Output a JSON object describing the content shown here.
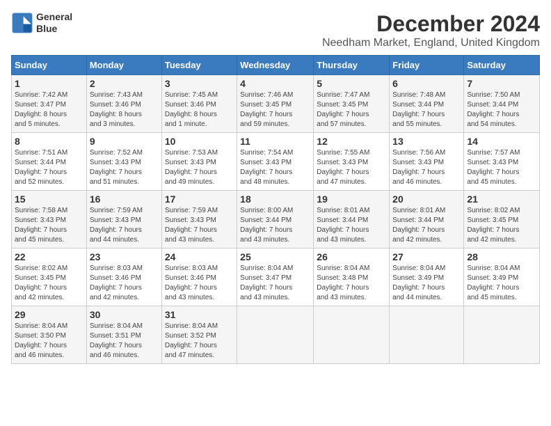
{
  "header": {
    "logo_line1": "General",
    "logo_line2": "Blue",
    "month": "December 2024",
    "location": "Needham Market, England, United Kingdom"
  },
  "weekdays": [
    "Sunday",
    "Monday",
    "Tuesday",
    "Wednesday",
    "Thursday",
    "Friday",
    "Saturday"
  ],
  "weeks": [
    [
      {
        "day": "1",
        "info": "Sunrise: 7:42 AM\nSunset: 3:47 PM\nDaylight: 8 hours\nand 5 minutes."
      },
      {
        "day": "2",
        "info": "Sunrise: 7:43 AM\nSunset: 3:46 PM\nDaylight: 8 hours\nand 3 minutes."
      },
      {
        "day": "3",
        "info": "Sunrise: 7:45 AM\nSunset: 3:46 PM\nDaylight: 8 hours\nand 1 minute."
      },
      {
        "day": "4",
        "info": "Sunrise: 7:46 AM\nSunset: 3:45 PM\nDaylight: 7 hours\nand 59 minutes."
      },
      {
        "day": "5",
        "info": "Sunrise: 7:47 AM\nSunset: 3:45 PM\nDaylight: 7 hours\nand 57 minutes."
      },
      {
        "day": "6",
        "info": "Sunrise: 7:48 AM\nSunset: 3:44 PM\nDaylight: 7 hours\nand 55 minutes."
      },
      {
        "day": "7",
        "info": "Sunrise: 7:50 AM\nSunset: 3:44 PM\nDaylight: 7 hours\nand 54 minutes."
      }
    ],
    [
      {
        "day": "8",
        "info": "Sunrise: 7:51 AM\nSunset: 3:44 PM\nDaylight: 7 hours\nand 52 minutes."
      },
      {
        "day": "9",
        "info": "Sunrise: 7:52 AM\nSunset: 3:43 PM\nDaylight: 7 hours\nand 51 minutes."
      },
      {
        "day": "10",
        "info": "Sunrise: 7:53 AM\nSunset: 3:43 PM\nDaylight: 7 hours\nand 49 minutes."
      },
      {
        "day": "11",
        "info": "Sunrise: 7:54 AM\nSunset: 3:43 PM\nDaylight: 7 hours\nand 48 minutes."
      },
      {
        "day": "12",
        "info": "Sunrise: 7:55 AM\nSunset: 3:43 PM\nDaylight: 7 hours\nand 47 minutes."
      },
      {
        "day": "13",
        "info": "Sunrise: 7:56 AM\nSunset: 3:43 PM\nDaylight: 7 hours\nand 46 minutes."
      },
      {
        "day": "14",
        "info": "Sunrise: 7:57 AM\nSunset: 3:43 PM\nDaylight: 7 hours\nand 45 minutes."
      }
    ],
    [
      {
        "day": "15",
        "info": "Sunrise: 7:58 AM\nSunset: 3:43 PM\nDaylight: 7 hours\nand 45 minutes."
      },
      {
        "day": "16",
        "info": "Sunrise: 7:59 AM\nSunset: 3:43 PM\nDaylight: 7 hours\nand 44 minutes."
      },
      {
        "day": "17",
        "info": "Sunrise: 7:59 AM\nSunset: 3:43 PM\nDaylight: 7 hours\nand 43 minutes."
      },
      {
        "day": "18",
        "info": "Sunrise: 8:00 AM\nSunset: 3:44 PM\nDaylight: 7 hours\nand 43 minutes."
      },
      {
        "day": "19",
        "info": "Sunrise: 8:01 AM\nSunset: 3:44 PM\nDaylight: 7 hours\nand 43 minutes."
      },
      {
        "day": "20",
        "info": "Sunrise: 8:01 AM\nSunset: 3:44 PM\nDaylight: 7 hours\nand 42 minutes."
      },
      {
        "day": "21",
        "info": "Sunrise: 8:02 AM\nSunset: 3:45 PM\nDaylight: 7 hours\nand 42 minutes."
      }
    ],
    [
      {
        "day": "22",
        "info": "Sunrise: 8:02 AM\nSunset: 3:45 PM\nDaylight: 7 hours\nand 42 minutes."
      },
      {
        "day": "23",
        "info": "Sunrise: 8:03 AM\nSunset: 3:46 PM\nDaylight: 7 hours\nand 42 minutes."
      },
      {
        "day": "24",
        "info": "Sunrise: 8:03 AM\nSunset: 3:46 PM\nDaylight: 7 hours\nand 43 minutes."
      },
      {
        "day": "25",
        "info": "Sunrise: 8:04 AM\nSunset: 3:47 PM\nDaylight: 7 hours\nand 43 minutes."
      },
      {
        "day": "26",
        "info": "Sunrise: 8:04 AM\nSunset: 3:48 PM\nDaylight: 7 hours\nand 43 minutes."
      },
      {
        "day": "27",
        "info": "Sunrise: 8:04 AM\nSunset: 3:49 PM\nDaylight: 7 hours\nand 44 minutes."
      },
      {
        "day": "28",
        "info": "Sunrise: 8:04 AM\nSunset: 3:49 PM\nDaylight: 7 hours\nand 45 minutes."
      }
    ],
    [
      {
        "day": "29",
        "info": "Sunrise: 8:04 AM\nSunset: 3:50 PM\nDaylight: 7 hours\nand 46 minutes."
      },
      {
        "day": "30",
        "info": "Sunrise: 8:04 AM\nSunset: 3:51 PM\nDaylight: 7 hours\nand 46 minutes."
      },
      {
        "day": "31",
        "info": "Sunrise: 8:04 AM\nSunset: 3:52 PM\nDaylight: 7 hours\nand 47 minutes."
      },
      null,
      null,
      null,
      null
    ]
  ]
}
